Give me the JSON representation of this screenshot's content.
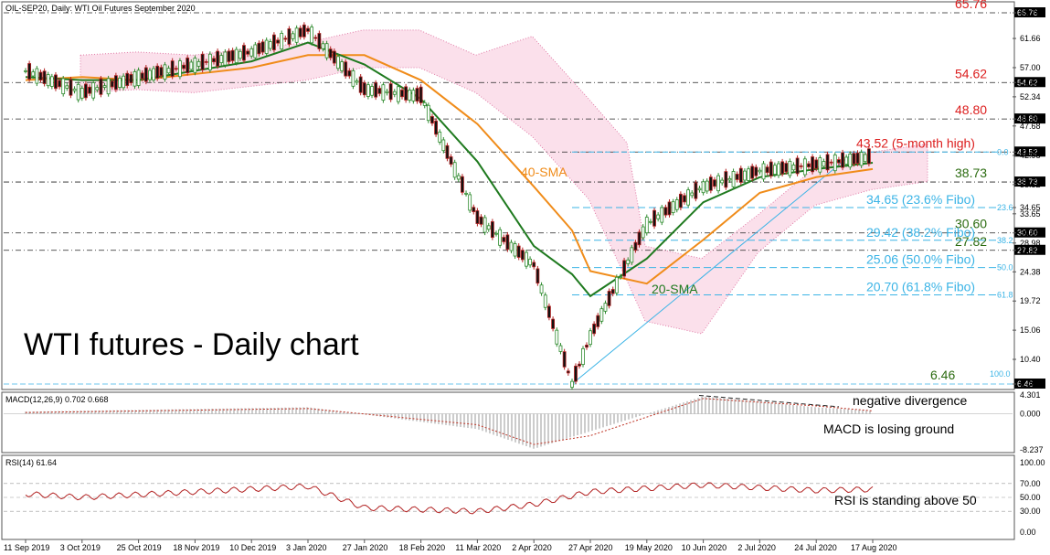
{
  "chart_data": [
    {
      "type": "line",
      "header": "OIL-SEP20, Daily:  WTI Oil Futures September 2020",
      "title": "WTI futures - Daily chart",
      "x_labels": [
        "11 Sep 2019",
        "3 Oct 2019",
        "25 Oct 2019",
        "18 Nov 2019",
        "10 Dec 2019",
        "3 Jan 2020",
        "27 Jan 2020",
        "18 Feb 2020",
        "11 Mar 2020",
        "2 Apr 2020",
        "27 Apr 2020",
        "19 May 2020",
        "10 Jun 2020",
        "2 Jul 2020",
        "24 Jul 2020",
        "17 Aug 2020"
      ],
      "y_ticks": [
        "65.76",
        "61.66",
        "57.00",
        "54.62",
        "52.34",
        "48.80",
        "47.68",
        "43.52",
        "42.98",
        "38.73",
        "38.32",
        "34.65",
        "33.65",
        "30.60",
        "28.98",
        "27.82",
        "24.38",
        "19.72",
        "15.06",
        "10.40",
        "6.46"
      ],
      "ylim": [
        6.46,
        65.76
      ],
      "price_series": {
        "name": "WTI",
        "x": [
          "11 Sep 2019",
          "3 Oct 2019",
          "25 Oct 2019",
          "18 Nov 2019",
          "10 Dec 2019",
          "3 Jan 2020",
          "27 Jan 2020",
          "18 Feb 2020",
          "11 Mar 2020",
          "2 Apr 2020",
          "21 Apr 2020",
          "27 Apr 2020",
          "19 May 2020",
          "10 Jun 2020",
          "2 Jul 2020",
          "24 Jul 2020",
          "17 Aug 2020"
        ],
        "values": [
          56.5,
          53.0,
          55.5,
          57.5,
          59.5,
          63.0,
          53.5,
          52.5,
          33.0,
          25.5,
          6.46,
          14.0,
          32.0,
          38.0,
          40.5,
          41.5,
          42.8
        ]
      },
      "sma20": {
        "name": "20-SMA",
        "values": [
          55.5,
          55.0,
          55.0,
          56.5,
          58.0,
          61.0,
          57.5,
          52.0,
          42.0,
          28.5,
          24.0,
          20.5,
          26.5,
          35.5,
          39.5,
          40.8,
          41.8
        ]
      },
      "sma40": {
        "name": "40-SMA",
        "values": [
          55.0,
          55.5,
          55.0,
          56.0,
          57.0,
          59.0,
          59.0,
          55.0,
          48.0,
          38.0,
          31.0,
          24.5,
          22.5,
          29.5,
          37.0,
          39.5,
          40.8
        ]
      },
      "levels": [
        {
          "label": "65.76",
          "value": 65.76,
          "color": "#dc1e1e"
        },
        {
          "label": "54.62",
          "value": 54.62,
          "color": "#dc1e1e"
        },
        {
          "label": "48.80",
          "value": 48.8,
          "color": "#dc1e1e"
        },
        {
          "label": "43.52 (5-month high)",
          "value": 43.52,
          "color": "#dc1e1e"
        },
        {
          "label": "38.73",
          "value": 38.73,
          "color": "#2b6b10"
        },
        {
          "label": "30.60",
          "value": 30.6,
          "color": "#2b6b10"
        },
        {
          "label": "27.82",
          "value": 27.82,
          "color": "#2b6b10"
        },
        {
          "label": "6.46",
          "value": 6.46,
          "color": "#2b6b10"
        }
      ],
      "fibo": [
        {
          "label": "34.65 (23.6% Fibo)",
          "value": 34.65,
          "tag": "23.6"
        },
        {
          "label": "29.42 (38.2% Fibo)",
          "value": 29.42,
          "tag": "38.2"
        },
        {
          "label": "25.06 (50.0% Fibo)",
          "value": 25.06,
          "tag": "50.0"
        },
        {
          "label": "20.70 (61.8% Fibo)",
          "value": 20.7,
          "tag": "61.8"
        }
      ],
      "fibo_tags": {
        "top": "0.0",
        "bottom": "100.0"
      },
      "annotations": [
        "40-SMA",
        "20-SMA"
      ],
      "colors": {
        "price_up": "#2d8a2d",
        "price_down": "#b22222",
        "sma20": "#1f7a1f",
        "sma40": "#f08c1a",
        "fibo": "#3bb4e6",
        "level": "#dc1e1e",
        "support": "#2b6b10"
      }
    },
    {
      "type": "bar",
      "name": "MACD(12,26,9) 0.702 0.668",
      "y_ticks": [
        "4.301",
        "0.000",
        "-8.237"
      ],
      "ylim": [
        -8.237,
        4.301
      ],
      "x": [
        "11 Sep 2019",
        "3 Jan 2020",
        "11 Mar 2020",
        "2 Apr 2020",
        "27 Apr 2020",
        "10 Jun 2020",
        "24 Jul 2020",
        "17 Aug 2020"
      ],
      "values": [
        0.5,
        1.5,
        -3.5,
        -8.0,
        -4.0,
        4.0,
        1.5,
        0.7
      ],
      "signal": [
        0.3,
        1.2,
        -2.5,
        -7.0,
        -5.0,
        3.5,
        1.8,
        0.668
      ],
      "annotations": [
        "negative divergence",
        "MACD is losing ground"
      ]
    },
    {
      "type": "line",
      "name": "RSI(14) 61.64",
      "y_ticks": [
        "100.00",
        "70.00",
        "50.00",
        "30.00",
        "0.00"
      ],
      "ylim": [
        0,
        100
      ],
      "x": [
        "11 Sep 2019",
        "3 Oct 2019",
        "3 Jan 2020",
        "27 Jan 2020",
        "11 Mar 2020",
        "2 Apr 2020",
        "27 Apr 2020",
        "10 Jun 2020",
        "24 Jul 2020",
        "17 Aug 2020"
      ],
      "values": [
        55,
        50,
        66,
        35,
        30,
        40,
        58,
        68,
        60,
        61.64
      ],
      "annotations": [
        "RSI is standing above 50"
      ]
    }
  ]
}
